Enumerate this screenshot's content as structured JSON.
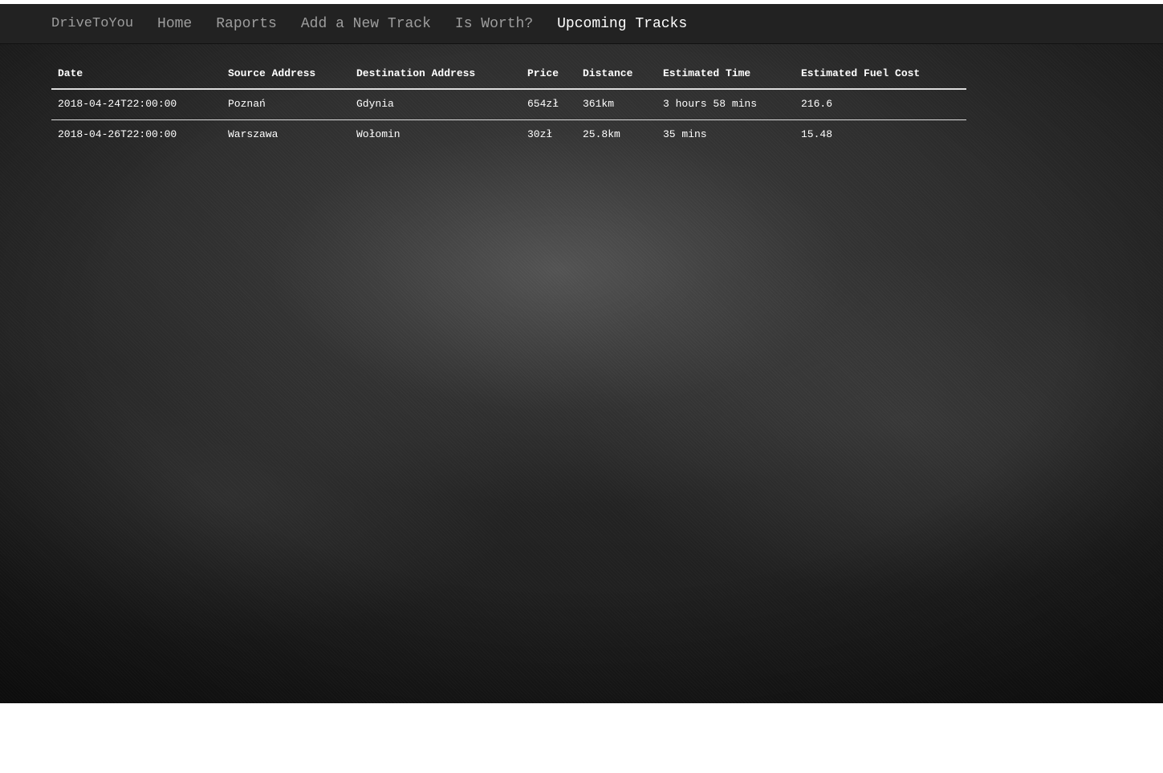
{
  "navbar": {
    "brand": "DriveToYou",
    "links": [
      {
        "label": "Home",
        "active": false
      },
      {
        "label": "Raports",
        "active": false
      },
      {
        "label": "Add a New Track",
        "active": false
      },
      {
        "label": "Is Worth?",
        "active": false
      },
      {
        "label": "Upcoming Tracks",
        "active": true
      }
    ]
  },
  "table": {
    "headers": [
      "Date",
      "Source Address",
      "Destination Address",
      "Price",
      "Distance",
      "Estimated Time",
      "Estimated Fuel Cost"
    ],
    "rows": [
      [
        "2018-04-24T22:00:00",
        "Poznań",
        "Gdynia",
        "654zł",
        "361km",
        "3 hours 58 mins",
        "216.6"
      ],
      [
        "2018-04-26T22:00:00",
        "Warszawa",
        "Wołomin",
        "30zł",
        "25.8km",
        "35 mins",
        "15.48"
      ]
    ]
  },
  "colors": {
    "navbar_bg": "#222222",
    "nav_link": "#9d9d9d",
    "nav_link_active": "#ffffff",
    "table_text": "#ffffff",
    "table_border": "#dddddd"
  }
}
